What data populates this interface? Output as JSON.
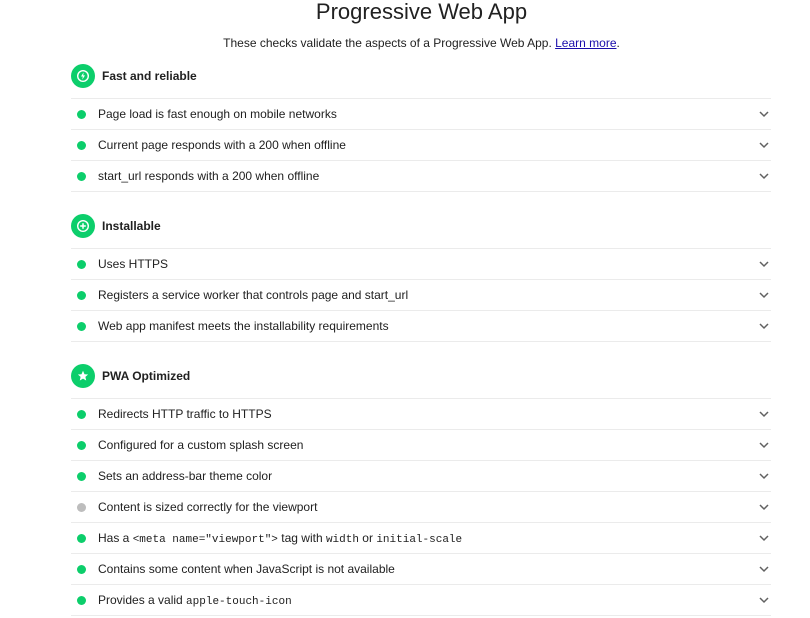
{
  "header": {
    "title": "Progressive Web App",
    "description": "These checks validate the aspects of a Progressive Web App.",
    "learn_more": "Learn more",
    "period": "."
  },
  "colors": {
    "pass": "#0cce6b",
    "not_applicable": "#bdbdbd",
    "link": "#1a0dab"
  },
  "groups": [
    {
      "title": "Fast and reliable",
      "icon": "lightning-bolt-icon",
      "audits": [
        {
          "title": "Page load is fast enough on mobile networks",
          "status": "pass"
        },
        {
          "title": "Current page responds with a 200 when offline",
          "status": "pass"
        },
        {
          "title": "start_url responds with a 200 when offline",
          "status": "pass"
        }
      ]
    },
    {
      "title": "Installable",
      "icon": "plus-icon",
      "audits": [
        {
          "title": "Uses HTTPS",
          "status": "pass"
        },
        {
          "title": "Registers a service worker that controls page and start_url",
          "status": "pass"
        },
        {
          "title": "Web app manifest meets the installability requirements",
          "status": "pass"
        }
      ]
    },
    {
      "title": "PWA Optimized",
      "icon": "star-icon",
      "audits": [
        {
          "title": "Redirects HTTP traffic to HTTPS",
          "status": "pass"
        },
        {
          "title": "Configured for a custom splash screen",
          "status": "pass"
        },
        {
          "title": "Sets an address-bar theme color",
          "status": "pass"
        },
        {
          "title": "Content is sized correctly for the viewport",
          "status": "not_applicable"
        },
        {
          "title_parts": [
            "Has a ",
            "<meta name=\"viewport\">",
            " tag with ",
            "width",
            " or ",
            "initial-scale"
          ],
          "status": "pass"
        },
        {
          "title": "Contains some content when JavaScript is not available",
          "status": "pass"
        },
        {
          "title_parts": [
            "Provides a valid ",
            "apple-touch-icon"
          ],
          "status": "pass"
        }
      ]
    }
  ]
}
